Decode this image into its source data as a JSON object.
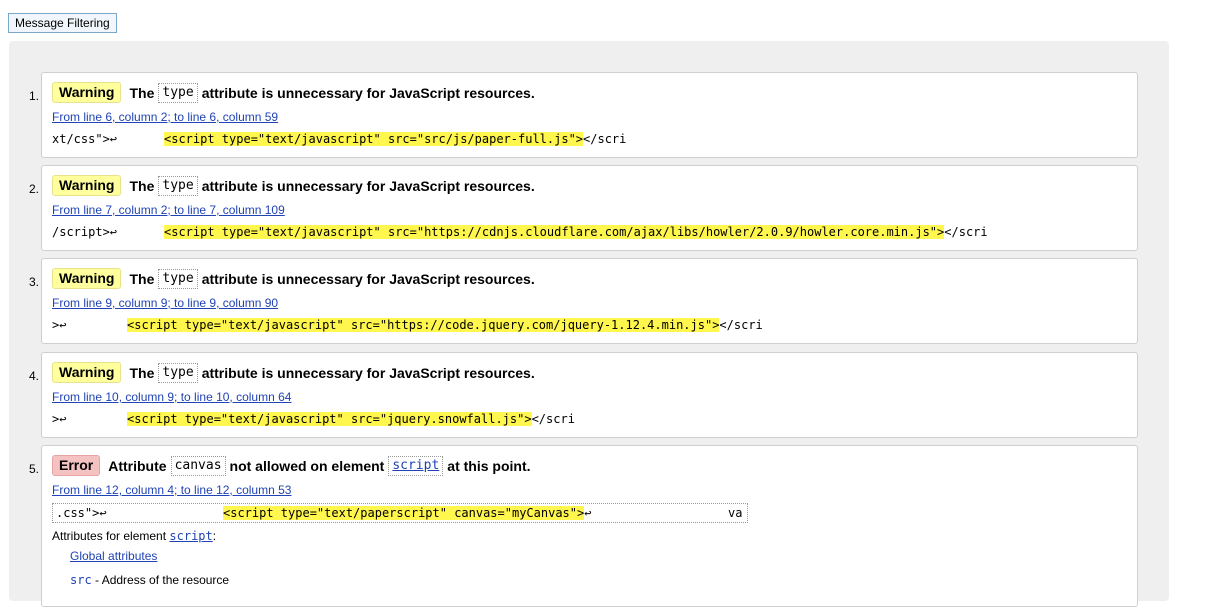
{
  "filter_button": {
    "label": "Message Filtering"
  },
  "messages": [
    {
      "number": "1.",
      "type_label": "Warning",
      "text_before": "The",
      "code": "type",
      "text_after": "attribute is unnecessary for JavaScript resources.",
      "location": "From line 6, column 2; to line 6, column 59",
      "extract_prefix": "xt/css\">↩",
      "extract_highlight": "<script type=\"text/javascript\" src=\"src/js/paper-full.js\">",
      "extract_suffix": "</scri"
    },
    {
      "number": "2.",
      "type_label": "Warning",
      "text_before": "The",
      "code": "type",
      "text_after": "attribute is unnecessary for JavaScript resources.",
      "location": "From line 7, column 2; to line 7, column 109",
      "extract_prefix": "/script>↩",
      "extract_highlight": "<script type=\"text/javascript\" src=\"https://cdnjs.cloudflare.com/ajax/libs/howler/2.0.9/howler.core.min.js\">",
      "extract_suffix": "</scri"
    },
    {
      "number": "3.",
      "type_label": "Warning",
      "text_before": "The",
      "code": "type",
      "text_after": "attribute is unnecessary for JavaScript resources.",
      "location": "From line 9, column 9; to line 9, column 90",
      "extract_prefix": ">↩",
      "extract_highlight": "<script type=\"text/javascript\" src=\"https://code.jquery.com/jquery-1.12.4.min.js\">",
      "extract_suffix": "</scri"
    },
    {
      "number": "4.",
      "type_label": "Warning",
      "text_before": "The",
      "code": "type",
      "text_after": "attribute is unnecessary for JavaScript resources.",
      "location": "From line 10, column 9; to line 10, column 64",
      "extract_prefix": ">↩",
      "extract_highlight": "<script type=\"text/javascript\" src=\"jquery.snowfall.js\">",
      "extract_suffix": "</scri"
    },
    {
      "number": "5.",
      "type_label": "Error",
      "text_before": "Attribute",
      "code": "canvas",
      "text_middle": "not allowed on element",
      "code2": "script",
      "text_after": "at this point.",
      "location": "From line 12, column 4; to line 12, column 53",
      "extract_prefix": ".css\">↩",
      "extract_highlight": "<script type=\"text/paperscript\" canvas=\"myCanvas\">",
      "extract_suffix": "↩",
      "extract_tail": "va",
      "attrs_label": "Attributes for element",
      "attrs_element": "script",
      "attrs_colon": ":",
      "global_attributes": "Global attributes",
      "src_attr": "src",
      "src_desc": "- Address of the resource"
    }
  ]
}
